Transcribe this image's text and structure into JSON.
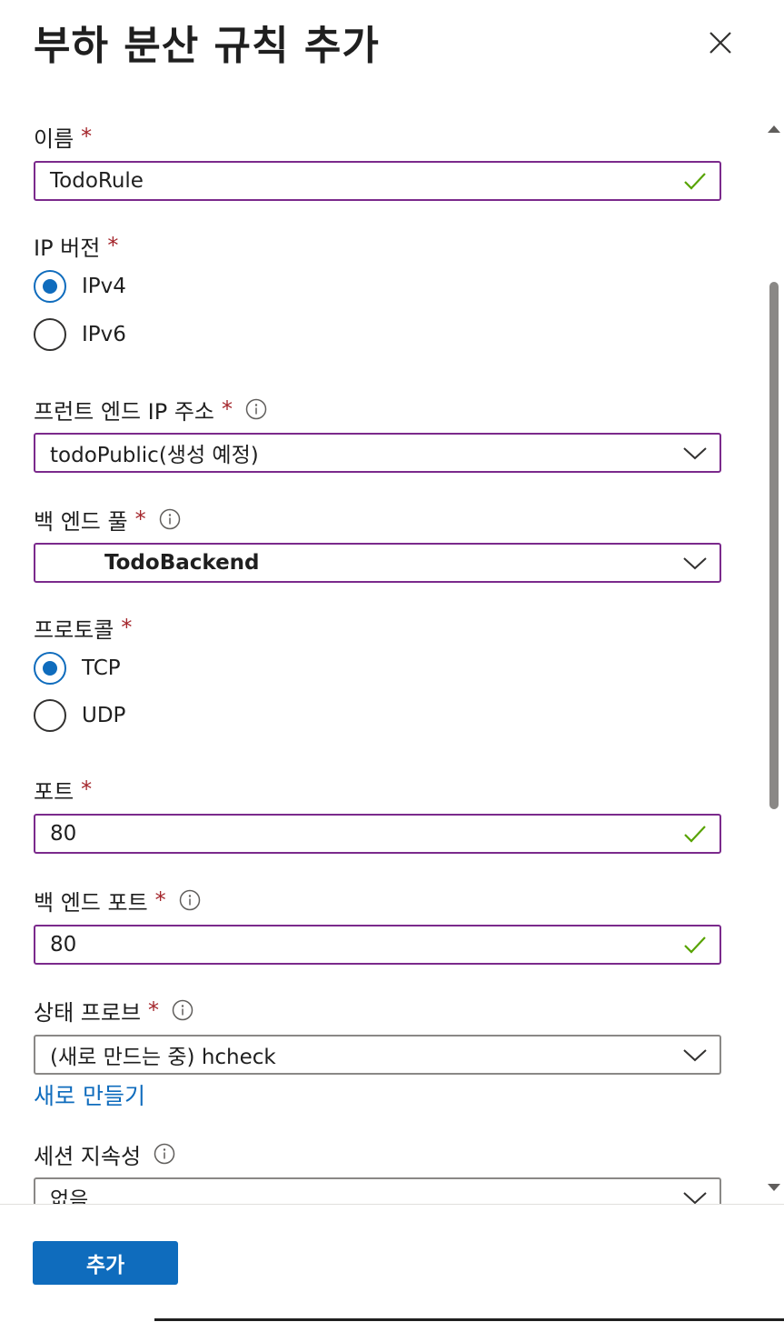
{
  "panel": {
    "title": "부하 분산 규칙 추가"
  },
  "form": {
    "name": {
      "label": "이름",
      "required": "*",
      "value": "TodoRule"
    },
    "ip_version": {
      "label": "IP 버전",
      "required": "*",
      "options": [
        {
          "label": "IPv4",
          "checked": true
        },
        {
          "label": "IPv6",
          "checked": false
        }
      ]
    },
    "frontend_ip": {
      "label": "프런트 엔드 IP 주소",
      "required": "*",
      "value": "todoPublic(생성 예정)"
    },
    "backend_pool": {
      "label": "백 엔드 풀",
      "required": "*",
      "value": "TodoBackend"
    },
    "protocol": {
      "label": "프로토콜",
      "required": "*",
      "options": [
        {
          "label": "TCP",
          "checked": true
        },
        {
          "label": "UDP",
          "checked": false
        }
      ]
    },
    "port": {
      "label": "포트",
      "required": "*",
      "value": "80"
    },
    "backend_port": {
      "label": "백 엔드 포트",
      "required": "*",
      "value": "80"
    },
    "health_probe": {
      "label": "상태 프로브",
      "required": "*",
      "value": "(새로 만드는 중) hcheck",
      "create_link": "새로 만들기"
    },
    "session_persistence": {
      "label": "세션 지속성",
      "value": "없음"
    }
  },
  "footer": {
    "add_button": "추가"
  },
  "colors": {
    "accent": "#0f6cbd",
    "field_border": "#7b2a8c",
    "required": "#a4262c",
    "valid_check": "#57a300"
  }
}
